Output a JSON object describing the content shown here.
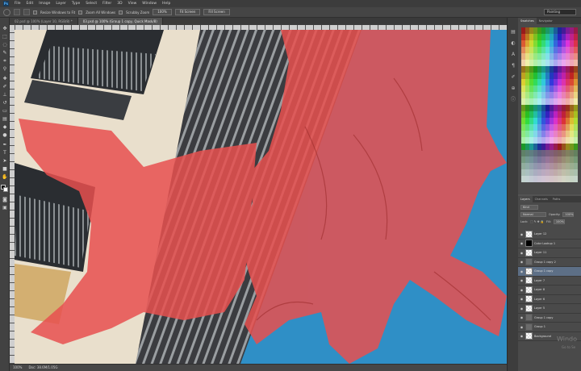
{
  "menu": {
    "logo": "Ps",
    "items": [
      "File",
      "Edit",
      "Image",
      "Layer",
      "Type",
      "Select",
      "Filter",
      "3D",
      "View",
      "Window",
      "Help"
    ]
  },
  "options": {
    "resize_windows_label": "Resize Windows to Fit",
    "zoom_all_label": "Zoom All Windows",
    "scrubby_zoom_label": "Scrubby Zoom",
    "btn_100": "100%",
    "btn_fit": "Fit Screen",
    "btn_fill": "Fill Screen",
    "workspace": "Painting"
  },
  "tabs": [
    {
      "label": "02.psd @ 100% (Layer 10, RGB/8) *"
    },
    {
      "label": "03.psd @ 100% (Group 1 copy, Quick Mask/8)"
    }
  ],
  "status": {
    "zoom": "100%",
    "doc": "Doc: 38.6M/1.05G"
  },
  "panels": {
    "swatches_tabs": [
      "Swatches",
      "Navigator"
    ],
    "layers_tabs": [
      "Layers",
      "Channels",
      "Paths"
    ],
    "kind_label": "Kind",
    "blend_mode": "Normal",
    "opacity_label": "Opacity:",
    "opacity_value": "100%",
    "lock_label": "Lock:",
    "fill_label": "Fill:",
    "fill_value": "100%"
  },
  "layers": [
    {
      "name": "Layer 12",
      "type": "layer",
      "visible": true
    },
    {
      "name": "Color Lookup 1",
      "type": "adjustment",
      "visible": true
    },
    {
      "name": "Layer 11",
      "type": "layer",
      "visible": true
    },
    {
      "name": "Group 1 copy 2",
      "type": "folder",
      "visible": true
    },
    {
      "name": "Group 1 copy",
      "type": "layer",
      "visible": true,
      "active": true
    },
    {
      "name": "Layer 7",
      "type": "layer",
      "visible": true
    },
    {
      "name": "Layer 8",
      "type": "layer",
      "visible": true
    },
    {
      "name": "Layer 6",
      "type": "layer",
      "visible": true
    },
    {
      "name": "Layer 5",
      "type": "layer",
      "visible": true
    },
    {
      "name": "Group 1 copy",
      "type": "folder",
      "visible": true
    },
    {
      "name": "Group 1",
      "type": "folder",
      "visible": true
    },
    {
      "name": "Background",
      "type": "layer",
      "visible": true
    }
  ],
  "watermark": {
    "line1": "Windo",
    "line2": "Go to Se"
  },
  "colors": {
    "quick_mask": "#e8504f",
    "sky": "#2f8fc6",
    "building": "#e9dfcc",
    "ui_dark": "#424242"
  },
  "icons": {
    "toolbar": [
      "move-icon",
      "marquee-icon",
      "lasso-icon",
      "quick-select-icon",
      "crop-icon",
      "eyedropper-icon",
      "healing-icon",
      "brush-icon",
      "stamp-icon",
      "history-brush-icon",
      "eraser-icon",
      "gradient-icon",
      "blur-icon",
      "dodge-icon",
      "pen-icon",
      "type-icon",
      "path-select-icon",
      "shape-icon",
      "hand-icon",
      "zoom-icon"
    ]
  }
}
